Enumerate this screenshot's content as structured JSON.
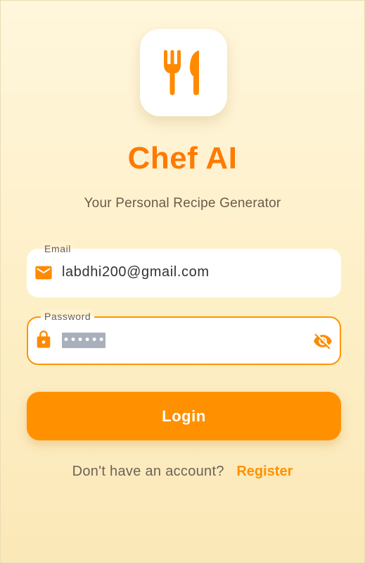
{
  "header": {
    "icon": "restaurant-icon",
    "title": "Chef AI",
    "subtitle": "Your Personal Recipe Generator"
  },
  "form": {
    "email": {
      "label": "Email",
      "value": "labdhi200@gmail.com",
      "icon": "mail-icon"
    },
    "password": {
      "label": "Password",
      "value": "••••••",
      "icon": "lock-icon",
      "toggle_icon": "visibility-off-icon"
    },
    "login_label": "Login"
  },
  "footer": {
    "prompt": "Don't have an account?",
    "register_label": "Register"
  },
  "colors": {
    "accent": "#ff9100",
    "title": "#ff7a00",
    "background_top": "#fff6dc",
    "background_bottom": "#fbe8b8"
  }
}
